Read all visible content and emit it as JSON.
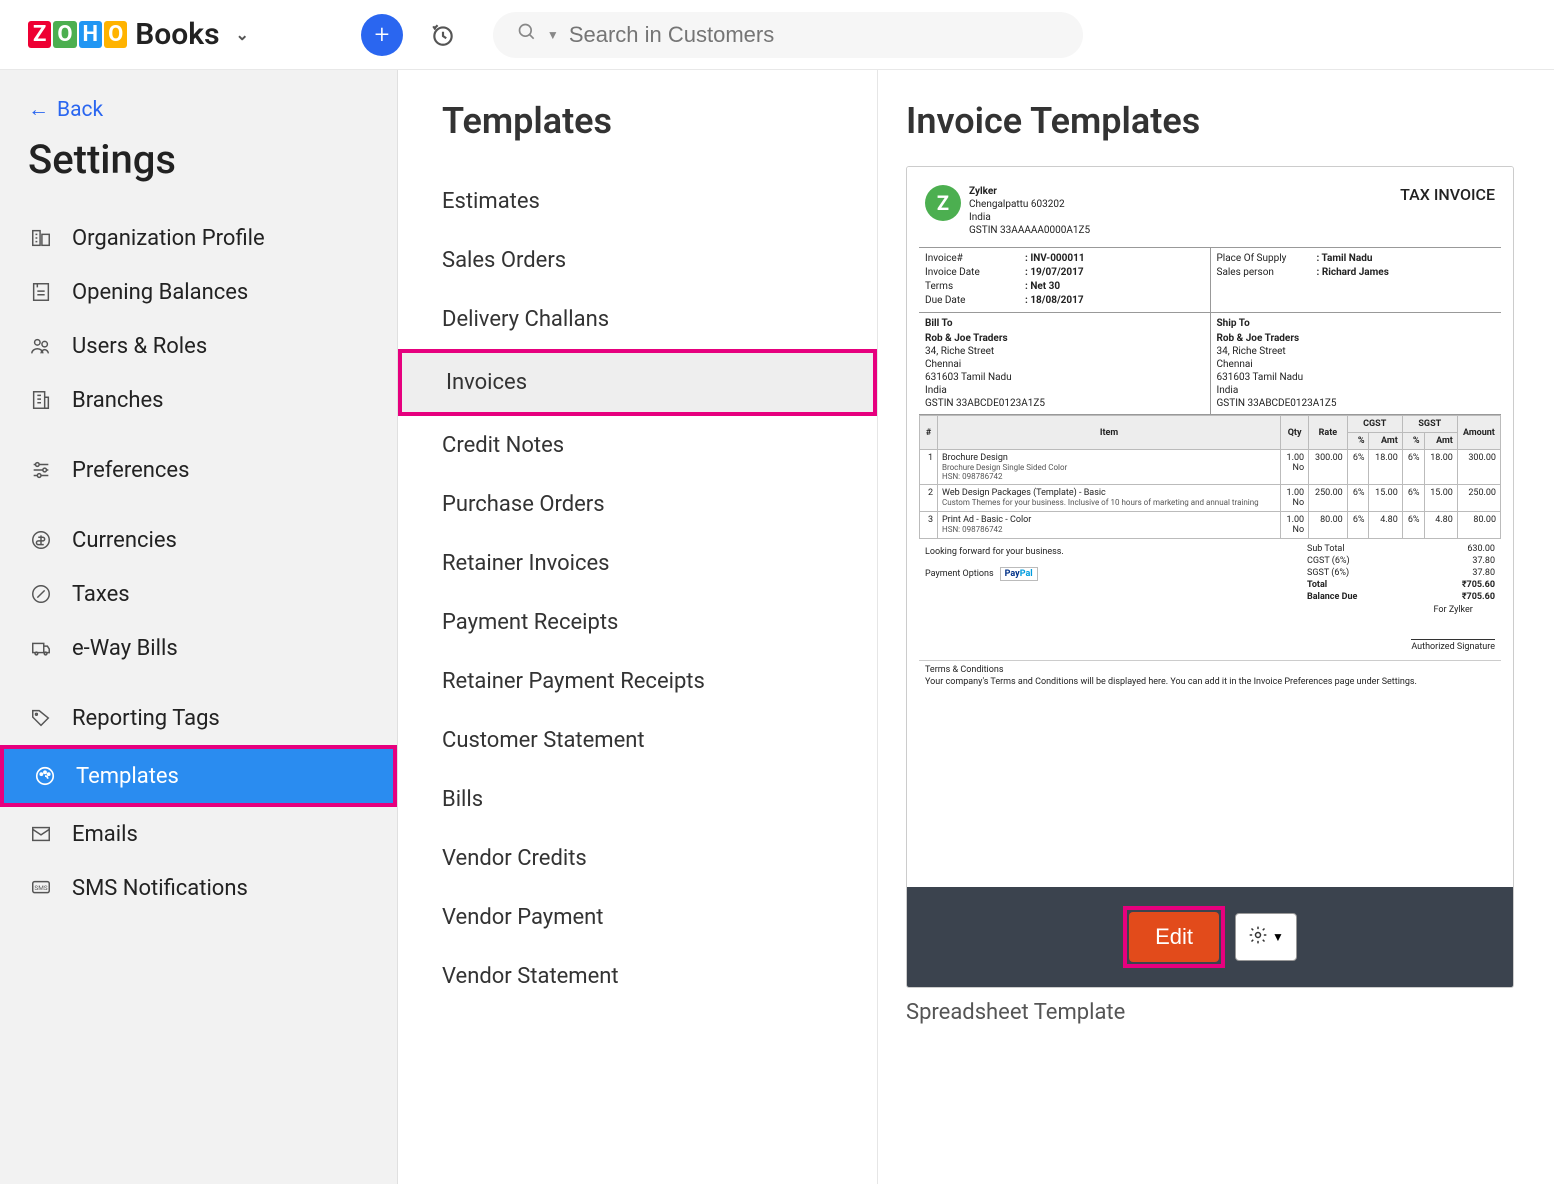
{
  "header": {
    "brand": "Books",
    "search_placeholder": "Search in Customers"
  },
  "sidebar": {
    "back_label": "Back",
    "title": "Settings",
    "items": [
      {
        "icon": "org-icon",
        "label": "Organization Profile"
      },
      {
        "icon": "opening-icon",
        "label": "Opening Balances"
      },
      {
        "icon": "users-icon",
        "label": "Users & Roles"
      },
      {
        "icon": "branches-icon",
        "label": "Branches"
      },
      {
        "icon": "prefs-icon",
        "label": "Preferences"
      },
      {
        "icon": "currency-icon",
        "label": "Currencies"
      },
      {
        "icon": "taxes-icon",
        "label": "Taxes"
      },
      {
        "icon": "eway-icon",
        "label": "e-Way Bills"
      },
      {
        "icon": "tags-icon",
        "label": "Reporting Tags"
      },
      {
        "icon": "templates-icon",
        "label": "Templates"
      },
      {
        "icon": "emails-icon",
        "label": "Emails"
      },
      {
        "icon": "sms-icon",
        "label": "SMS Notifications"
      }
    ],
    "active_index": 9
  },
  "templates_col": {
    "heading": "Templates",
    "items": [
      "Estimates",
      "Sales Orders",
      "Delivery Challans",
      "Invoices",
      "Credit Notes",
      "Purchase Orders",
      "Retainer Invoices",
      "Payment Receipts",
      "Retainer Payment Receipts",
      "Customer Statement",
      "Bills",
      "Vendor Credits",
      "Vendor Payment",
      "Vendor Statement"
    ],
    "selected_index": 3
  },
  "right": {
    "heading": "Invoice Templates",
    "card_label": "Spreadsheet Template",
    "edit_label": "Edit"
  },
  "preview": {
    "company": {
      "name": "Zylker",
      "line2": "Chengalpattu  603202",
      "line3": "India",
      "gstin": "GSTIN 33AAAAA0000A1Z5",
      "avatar": "Z"
    },
    "title": "TAX INVOICE",
    "meta_left": [
      {
        "k": "Invoice#",
        "v": "INV-000011"
      },
      {
        "k": "Invoice Date",
        "v": "19/07/2017"
      },
      {
        "k": "Terms",
        "v": "Net 30"
      },
      {
        "k": "Due Date",
        "v": "18/08/2017"
      }
    ],
    "meta_right": [
      {
        "k": "Place Of Supply",
        "v": "Tamil Nadu"
      },
      {
        "k": "Sales person",
        "v": "Richard James"
      }
    ],
    "bill_to_label": "Bill To",
    "ship_to_label": "Ship To",
    "address": {
      "name": "Rob & Joe Traders",
      "l1": "34, Riche Street",
      "l2": "Chennai",
      "l3": "631603 Tamil Nadu",
      "l4": "India",
      "gstin": "GSTIN 33ABCDE0123A1Z5"
    },
    "table_headers": {
      "num": "#",
      "item": "Item",
      "qty": "Qty",
      "rate": "Rate",
      "cgst": "CGST",
      "sgst": "SGST",
      "pct": "%",
      "amt": "Amt",
      "amount": "Amount"
    },
    "items": [
      {
        "n": "1",
        "name": "Brochure Design",
        "sub": "Brochure Design Single Sided Color",
        "hsn": "HSN: 098786742",
        "qty": "1.00",
        "no": "No",
        "rate": "300.00",
        "cp": "6%",
        "ca": "18.00",
        "sp": "6%",
        "sa": "18.00",
        "amt": "300.00"
      },
      {
        "n": "2",
        "name": "Web Design Packages (Template) - Basic",
        "sub": "Custom Themes for your business. Inclusive of 10 hours of marketing and annual training",
        "hsn": "",
        "qty": "1.00",
        "no": "No",
        "rate": "250.00",
        "cp": "6%",
        "ca": "15.00",
        "sp": "6%",
        "sa": "15.00",
        "amt": "250.00"
      },
      {
        "n": "3",
        "name": "Print Ad - Basic - Color",
        "sub": "",
        "hsn": "HSN: 098786742",
        "qty": "1.00",
        "no": "No",
        "rate": "80.00",
        "cp": "6%",
        "ca": "4.80",
        "sp": "6%",
        "sa": "4.80",
        "amt": "80.00"
      }
    ],
    "lookfwd": "Looking forward for your business.",
    "payopt_label": "Payment Options",
    "paypal": "PayPal",
    "totals": [
      {
        "k": "Sub Total",
        "v": "630.00"
      },
      {
        "k": "CGST (6%)",
        "v": "37.80"
      },
      {
        "k": "SGST (6%)",
        "v": "37.80"
      },
      {
        "k": "Total",
        "v": "₹705.60",
        "b": true
      },
      {
        "k": "Balance Due",
        "v": "₹705.60",
        "b": true
      }
    ],
    "tc_title": "Terms & Conditions",
    "tc_body": "Your company's Terms and Conditions will be displayed here. You can add it in the Invoice Preferences page under Settings.",
    "for_label": "For Zylker",
    "sig_label": "Authorized Signature"
  }
}
